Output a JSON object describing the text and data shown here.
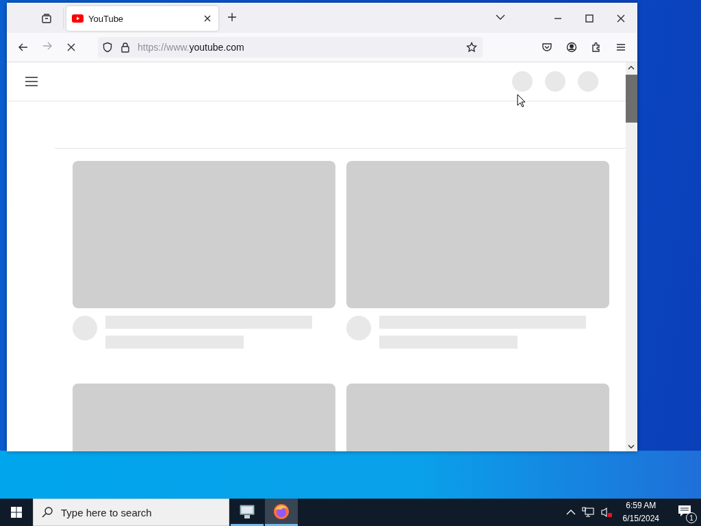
{
  "browser": {
    "tabs": [
      {
        "title": "YouTube",
        "selected": true
      }
    ],
    "address": {
      "prefix": "https://www.",
      "domain": "youtube.com"
    },
    "loading": true
  },
  "taskbar": {
    "search": {
      "placeholder": "Type here to search"
    },
    "apps": [
      {
        "kind": "explorer",
        "selected": false
      },
      {
        "kind": "firefox",
        "selected": true
      }
    ],
    "clock": {
      "time": "6:59 AM",
      "date": "6/15/2024"
    },
    "notifications": {
      "count": "1"
    }
  }
}
